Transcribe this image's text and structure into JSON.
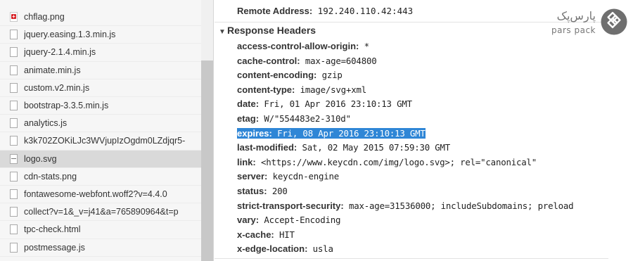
{
  "files": [
    {
      "name": "chflag.png",
      "icon": "png-red",
      "selected": false
    },
    {
      "name": "jquery.easing.1.3.min.js",
      "icon": "doc",
      "selected": false
    },
    {
      "name": "jquery-2.1.4.min.js",
      "icon": "doc",
      "selected": false
    },
    {
      "name": "animate.min.js",
      "icon": "doc",
      "selected": false
    },
    {
      "name": "custom.v2.min.js",
      "icon": "doc",
      "selected": false
    },
    {
      "name": "bootstrap-3.3.5.min.js",
      "icon": "doc",
      "selected": false
    },
    {
      "name": "analytics.js",
      "icon": "doc",
      "selected": false
    },
    {
      "name": "k3k702ZOKiLJc3WVjupIzOgdm0LZdjqr5-",
      "icon": "doc",
      "selected": false
    },
    {
      "name": "logo.svg",
      "icon": "svg-doc",
      "selected": true
    },
    {
      "name": "cdn-stats.png",
      "icon": "doc",
      "selected": false
    },
    {
      "name": "fontawesome-webfont.woff2?v=4.4.0",
      "icon": "doc",
      "selected": false
    },
    {
      "name": "collect?v=1&_v=j41&a=765890964&t=p",
      "icon": "doc",
      "selected": false
    },
    {
      "name": "tpc-check.html",
      "icon": "doc",
      "selected": false
    },
    {
      "name": "postmessage.js",
      "icon": "doc",
      "selected": false
    }
  ],
  "remote": {
    "key": "Remote Address:",
    "value": " 192.240.110.42:443"
  },
  "section": {
    "arrow": "▼",
    "title": "Response Headers"
  },
  "headers": [
    {
      "key": "access-control-allow-origin:",
      "value": " *",
      "highlight": false
    },
    {
      "key": "cache-control:",
      "value": " max-age=604800",
      "highlight": false
    },
    {
      "key": "content-encoding:",
      "value": " gzip",
      "highlight": false
    },
    {
      "key": "content-type:",
      "value": " image/svg+xml",
      "highlight": false
    },
    {
      "key": "date:",
      "value": " Fri, 01 Apr 2016 23:10:13 GMT",
      "highlight": false
    },
    {
      "key": "etag:",
      "value": " W/\"554483e2-310d\"",
      "highlight": false
    },
    {
      "key": "expires:",
      "value": " Fri, 08 Apr 2016 23:10:13 GMT",
      "highlight": true
    },
    {
      "key": "last-modified:",
      "value": " Sat, 02 May 2015 07:59:30 GMT",
      "highlight": false
    },
    {
      "key": "link:",
      "value": " <https://www.keycdn.com/img/logo.svg>; rel=\"canonical\"",
      "highlight": false
    },
    {
      "key": "server:",
      "value": " keycdn-engine",
      "highlight": false
    },
    {
      "key": "status:",
      "value": " 200",
      "highlight": false
    },
    {
      "key": "strict-transport-security:",
      "value": " max-age=31536000; includeSubdomains; preload",
      "highlight": false
    },
    {
      "key": "vary:",
      "value": " Accept-Encoding",
      "highlight": false
    },
    {
      "key": "x-cache:",
      "value": " HIT",
      "highlight": false
    },
    {
      "key": "x-edge-location:",
      "value": " usla",
      "highlight": false
    }
  ],
  "logo": {
    "fa": "پارس‌پک",
    "en": "pars pack"
  },
  "colors": {
    "selection": "#2f86d6",
    "selected_row": "#d9d9d9",
    "logo": "#6f6f6f"
  }
}
